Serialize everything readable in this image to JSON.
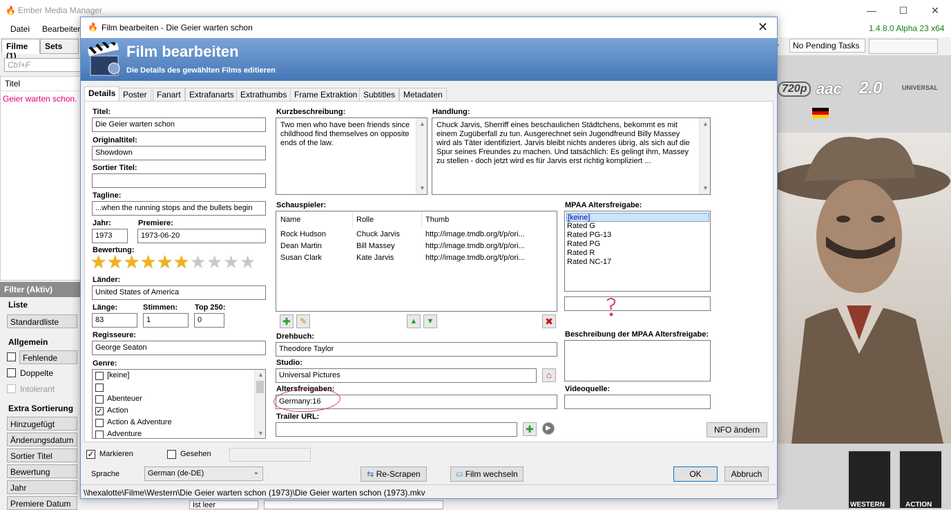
{
  "app": {
    "title": "Ember Media Manager",
    "menu": [
      "Datei",
      "Bearbeiten"
    ],
    "version": "1.4.8.0 Alpha 23 x64",
    "pending_tasks": "No Pending Tasks",
    "pending_prefix": "r",
    "left_tabs": [
      "Filme (1)",
      "Sets"
    ],
    "filter_placeholder": "Ctrl+F",
    "list_header": "Titel",
    "list_item": "Geier warten schon.",
    "filter_head": "Filter (Aktiv)",
    "groups": {
      "liste": "Liste",
      "liste_btn": "Standardliste",
      "allgemein": "Allgemein",
      "fehlende": "Fehlende",
      "doppelte": "Doppelte",
      "intolerant": "Intolerant",
      "extra_sort": "Extra Sortierung",
      "sort_buttons": [
        "Hinzugefügt",
        "Änderungsdatum",
        "Sortier Titel",
        "Bewertung",
        "Jahr",
        "Premiere Datum"
      ],
      "ist_leer": "Ist leer"
    },
    "media_flags": [
      "720p",
      "aac",
      "2.0",
      "UNIVERSAL"
    ],
    "poster_labels": [
      "WESTERN",
      "ACTION"
    ]
  },
  "dialog": {
    "window_title": "Film bearbeiten - Die Geier warten schon",
    "banner_title": "Film bearbeiten",
    "banner_subtitle": "Die Details des gewählten Films editieren",
    "tabs": [
      "Details",
      "Poster",
      "Fanart",
      "Extrafanarts",
      "Extrathumbs",
      "Frame Extraktion",
      "Subtitles",
      "Metadaten"
    ],
    "labels": {
      "titel": "Titel:",
      "originaltitel": "Originaltitel:",
      "sortier_titel": "Sortier Titel:",
      "tagline": "Tagline:",
      "jahr": "Jahr:",
      "premiere": "Premiere:",
      "bewertung": "Bewertung:",
      "laender": "Länder:",
      "laenge": "Länge:",
      "stimmen": "Stimmen:",
      "top250": "Top 250:",
      "regisseure": "Regisseure:",
      "genre": "Genre:",
      "kurzbeschreibung": "Kurzbeschreibung:",
      "handlung": "Handlung:",
      "schauspieler": "Schauspieler:",
      "drehbuch": "Drehbuch:",
      "studio": "Studio:",
      "altersfreigaben": "Altersfreigaben:",
      "trailer_url": "Trailer URL:",
      "mpaa": "MPAA Altersfreigabe:",
      "mpaa_desc": "Beschreibung der MPAA Altersfreigabe:",
      "videoquelle": "Videoquelle:",
      "markieren": "Markieren",
      "gesehen": "Gesehen",
      "sprache": "Sprache"
    },
    "values": {
      "titel": "Die Geier warten schon",
      "originaltitel": "Showdown",
      "sortier_titel": "",
      "tagline": "...when the running stops and the bullets begin",
      "jahr": "1973",
      "premiere": "1973-06-20",
      "laender": "United States of America",
      "laenge": "83",
      "stimmen": "1",
      "top250": "0",
      "regisseure": "George Seaton",
      "kurzbeschreibung": "Two men who have been friends since childhood find themselves on opposite ends of the law.",
      "handlung": "Chuck Jarvis, Sherriff eines beschaulichen Städtchens, bekommt es mit einem Zugüberfall zu tun. Ausgerechnet sein Jugendfreund Billy Massey wird als Täter identifiziert. Jarvis bleibt nichts anderes übrig, als sich auf die Spur seines Freundes zu machen. Und tatsächlich: Es gelingt ihm, Massey zu stellen - doch jetzt wird es für Jarvis erst richtig kompliziert ...",
      "drehbuch": "Theodore Taylor",
      "studio": "Universal Pictures",
      "altersfreigaben": "Germany:16",
      "trailer_url": "",
      "mpaa_custom": "",
      "mpaa_desc": "",
      "videoquelle": "",
      "sprache": "German (de-DE)",
      "rating": 6,
      "rating_max": 10,
      "markieren": true,
      "gesehen": false
    },
    "genres": [
      {
        "label": "[keine]",
        "checked": false
      },
      {
        "label": "",
        "checked": false
      },
      {
        "label": "Abenteuer",
        "checked": false
      },
      {
        "label": "Action",
        "checked": true
      },
      {
        "label": "Action & Adventure",
        "checked": false
      },
      {
        "label": "Adventure",
        "checked": false
      }
    ],
    "cast": {
      "headers": [
        "Name",
        "Rolle",
        "Thumb"
      ],
      "rows": [
        [
          "Rock Hudson",
          "Chuck Jarvis",
          "http://image.tmdb.org/t/p/ori..."
        ],
        [
          "Dean Martin",
          "Bill Massey",
          "http://image.tmdb.org/t/p/ori..."
        ],
        [
          "Susan Clark",
          "Kate Jarvis",
          "http://image.tmdb.org/t/p/ori..."
        ]
      ]
    },
    "mpaa_options": [
      "[keine]",
      "Rated G",
      "Rated PG-13",
      "Rated PG",
      "Rated R",
      "Rated NC-17"
    ],
    "mpaa_selected": 0,
    "buttons": {
      "nfo": "NFO ändern",
      "rescrape": "Re-Scrapen",
      "change_movie": "Film wechseln",
      "ok": "OK",
      "cancel": "Abbruch"
    },
    "status_path": "\\\\hexalotte\\Filme\\Western\\Die Geier warten schon (1973)\\Die Geier warten schon (1973).mkv"
  },
  "colors": {
    "banner_top": "#7aa3d6",
    "banner_bottom": "#4577b8",
    "list_item": "#e0006a",
    "star_on": "#f2b21f",
    "annotation": "#d04060"
  }
}
